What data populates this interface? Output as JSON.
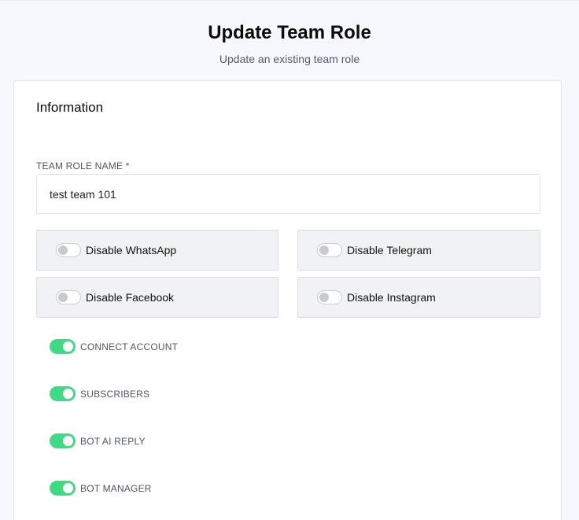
{
  "header": {
    "title": "Update Team Role",
    "subtitle": "Update an existing team role"
  },
  "form": {
    "section_title": "Information",
    "team_role_name": {
      "label": "TEAM ROLE NAME *",
      "value": "test team 101"
    },
    "channel_toggles": [
      {
        "label": "Disable WhatsApp",
        "enabled": false
      },
      {
        "label": "Disable Telegram",
        "enabled": false
      },
      {
        "label": "Disable Facebook",
        "enabled": false
      },
      {
        "label": "Disable Instagram",
        "enabled": false
      }
    ],
    "permissions": [
      {
        "label": "CONNECT ACCOUNT",
        "enabled": true
      },
      {
        "label": "SUBSCRIBERS",
        "enabled": true
      },
      {
        "label": "BOT AI REPLY",
        "enabled": true
      },
      {
        "label": "BOT MANAGER",
        "enabled": true
      }
    ]
  },
  "colors": {
    "toggle_on": "#3ddc84",
    "page_background": "#f5f8fc"
  }
}
